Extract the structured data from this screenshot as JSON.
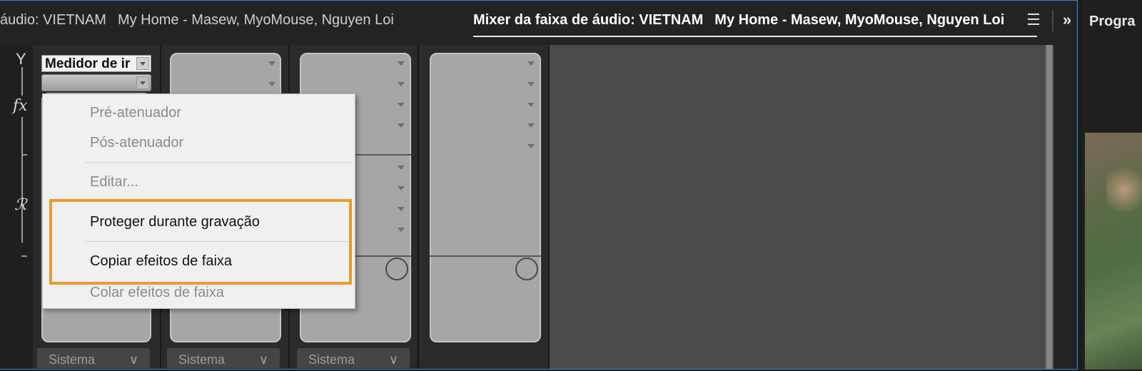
{
  "tabs": {
    "left_title": "áudio: VIETNAM",
    "left_sequence": "My Home - Masew, MyoMouse, Nguyen Loi",
    "active_title": "Mixer da faixa de áudio: VIETNAM",
    "active_sequence": "My Home - Masew, MyoMouse, Nguyen Loi",
    "menu_icon": "☰",
    "overflow_icon": "»"
  },
  "program_panel": {
    "title": "Progra"
  },
  "rail": {
    "top_icon": "Y",
    "fx_icon": "fx",
    "send_icon": "ℛ"
  },
  "track1": {
    "meter_dropdown_value": "Medidor de ir"
  },
  "context_menu": {
    "items": [
      {
        "label": "Pré-atenuador",
        "enabled": false
      },
      {
        "label": "Pós-atenuador",
        "enabled": false
      },
      {
        "label": "Editar...",
        "enabled": false
      },
      {
        "label": "Proteger durante gravação",
        "enabled": true
      },
      {
        "label": "Copiar efeitos de faixa",
        "enabled": true
      },
      {
        "label": "Colar efeitos de faixa",
        "enabled": false
      }
    ]
  },
  "output_buttons": [
    {
      "label": "Sistema",
      "chevron": "∨"
    },
    {
      "label": "Sistema",
      "chevron": "∨"
    },
    {
      "label": "Sistema",
      "chevron": "∨"
    }
  ],
  "colors": {
    "highlight": "#ec9a2c",
    "panel_focus_border": "#2d8ceb",
    "panel_bg": "#232323",
    "menu_bg": "#f0f0f0"
  }
}
